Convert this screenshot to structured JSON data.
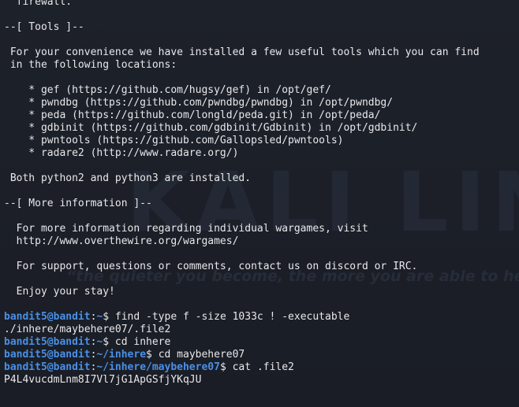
{
  "watermark": {
    "logo_text": "KALI LINUX",
    "tagline": "“the quieter you become, the more you are able to hear”"
  },
  "motd": [
    "  firewall.",
    "",
    "--[ Tools ]--",
    "",
    " For your convenience we have installed a few useful tools which you can find",
    " in the following locations:",
    "",
    "    * gef (https://github.com/hugsy/gef) in /opt/gef/",
    "    * pwndbg (https://github.com/pwndbg/pwndbg) in /opt/pwndbg/",
    "    * peda (https://github.com/longld/peda.git) in /opt/peda/",
    "    * gdbinit (https://github.com/gdbinit/Gdbinit) in /opt/gdbinit/",
    "    * pwntools (https://github.com/Gallopsled/pwntools)",
    "    * radare2 (http://www.radare.org/)",
    "",
    " Both python2 and python3 are installed.",
    "",
    "--[ More information ]--",
    "",
    "  For more information regarding individual wargames, visit",
    "  http://www.overthewire.org/wargames/",
    "",
    "  For support, questions or comments, contact us on discord or IRC.",
    "",
    "  Enjoy your stay!",
    ""
  ],
  "session": [
    {
      "type": "prompt",
      "user": "bandit5@bandit",
      "path": "~",
      "command": "find -type f -size 1033c ! -executable"
    },
    {
      "type": "output",
      "text": "./inhere/maybehere07/.file2"
    },
    {
      "type": "prompt",
      "user": "bandit5@bandit",
      "path": "~",
      "command": "cd inhere"
    },
    {
      "type": "prompt",
      "user": "bandit5@bandit",
      "path": "~/inhere",
      "command": "cd maybehere07"
    },
    {
      "type": "prompt",
      "user": "bandit5@bandit",
      "path": "~/inhere/maybehere07",
      "command": "cat .file2"
    },
    {
      "type": "output",
      "text": "P4L4vucdmLnm8I7Vl7jG1ApGSfjYKqJU"
    }
  ],
  "colors": {
    "background": "#1b1e26",
    "text": "#e8e8ea",
    "prompt": "#4a8fe6"
  }
}
